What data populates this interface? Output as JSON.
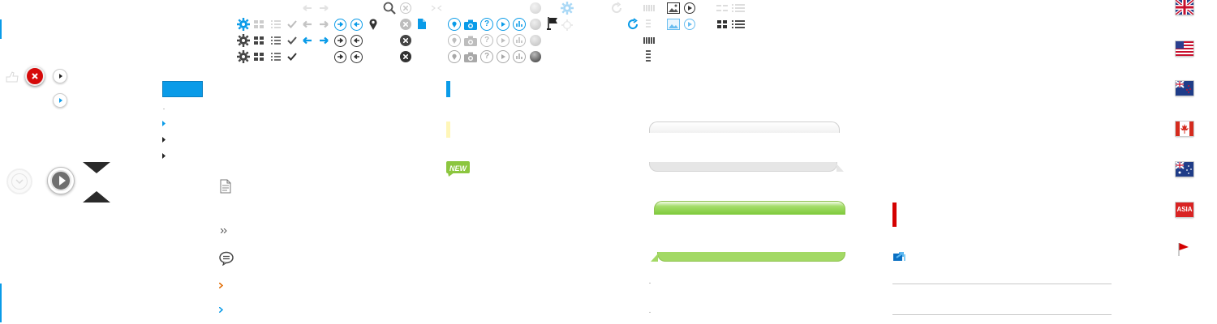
{
  "badges": {
    "new": "NEW",
    "asia": "ASIA"
  },
  "colors": {
    "blue": "#0a9be8",
    "grey": "#8a8a8a",
    "dark": "#3a3a3a",
    "red": "#d40000",
    "green": "#7cc93a",
    "orange": "#e06a00",
    "yellow": "#fff6b8"
  },
  "icons": {
    "gear": "gear-icon",
    "grid": "grid-view-icon",
    "list": "list-view-icon",
    "check": "check-icon",
    "arrow-left": "arrow-left-icon",
    "arrow-right": "arrow-right-icon",
    "search": "search-icon",
    "close": "close-icon",
    "location": "location-pin-icon",
    "document": "document-icon",
    "camera": "camera-icon",
    "help": "help-icon",
    "play": "play-icon",
    "chart": "bar-chart-icon",
    "flag": "flag-icon",
    "refresh": "refresh-icon",
    "image": "image-icon",
    "comment": "comment-icon",
    "chevron": "chevron-right-icon",
    "flags": [
      "uk-flag-icon",
      "us-flag-icon",
      "nz-flag-icon",
      "canada-flag-icon",
      "au-flag-icon",
      "asia-flag-icon",
      "red-pennant-icon"
    ]
  }
}
